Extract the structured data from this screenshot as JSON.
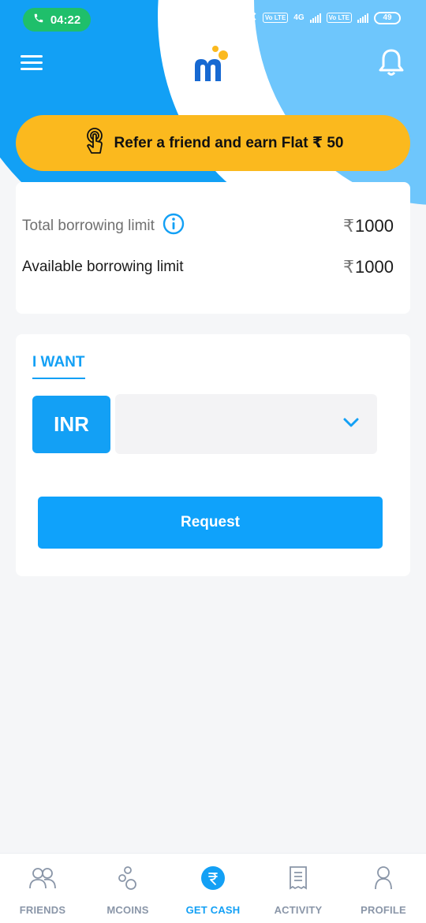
{
  "status_bar": {
    "time": "04:22",
    "network_badge_1": "Vo LTE",
    "network_type": "4G",
    "network_badge_2": "Vo LTE",
    "battery": "49"
  },
  "icons": {
    "menu": "hamburger-menu-icon",
    "logo": "mpokket-logo-icon",
    "notifications": "bell-icon",
    "refer": "tap-hand-icon",
    "info": "info-icon"
  },
  "refer_banner": {
    "label": "Refer a friend and earn Flat ₹ 50"
  },
  "limits": {
    "total_label": "Total borrowing limit",
    "total_value": "1000",
    "available_label": "Available borrowing limit",
    "available_value": "1000",
    "currency_symbol": "₹"
  },
  "want": {
    "tab_label": "I WANT",
    "currency_label": "INR",
    "amount_selected": "",
    "request_label": "Request"
  },
  "bottom_nav": {
    "items": [
      {
        "label": "FRIENDS",
        "icon": "friends-icon"
      },
      {
        "label": "MCOINS",
        "icon": "coins-icon"
      },
      {
        "label": "GET CASH",
        "icon": "rupee-icon",
        "active": true
      },
      {
        "label": "ACTIVITY",
        "icon": "receipt-icon"
      },
      {
        "label": "PROFILE",
        "icon": "profile-icon"
      }
    ]
  },
  "colors": {
    "primary": "#13a0f5",
    "accent_yellow": "#fbb91e",
    "call_green": "#1fbf6b",
    "header_light_blue": "#6ec6fc"
  }
}
